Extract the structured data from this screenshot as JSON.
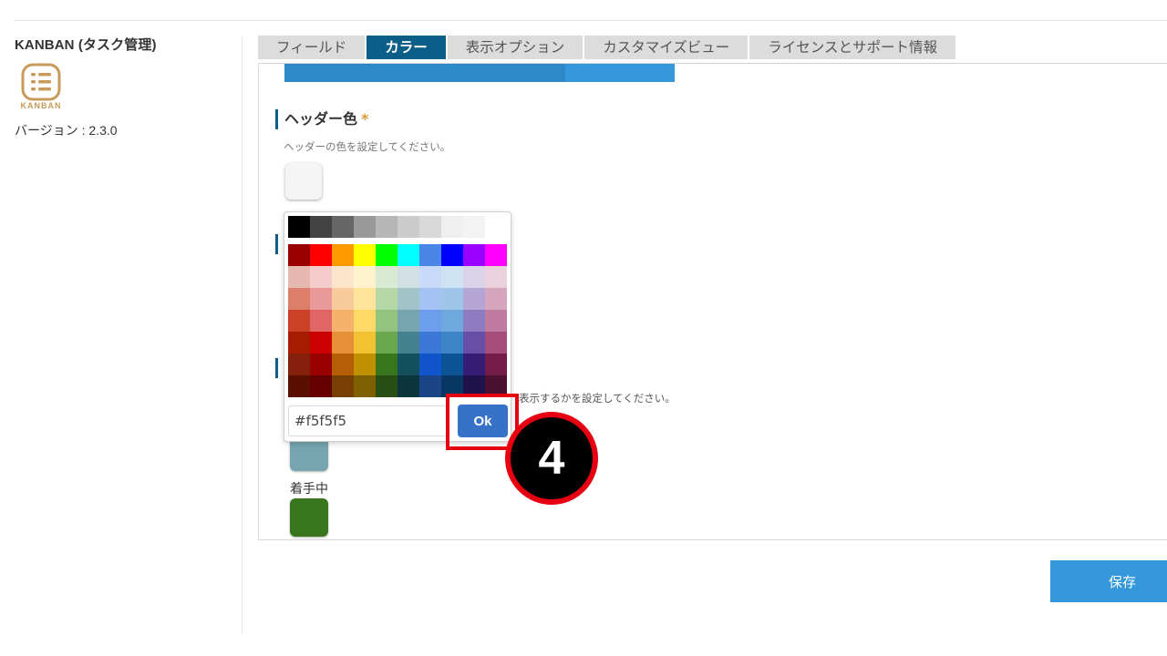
{
  "sidebar": {
    "app_name": "KANBAN (タスク管理)",
    "logo_caption": "KANBAN",
    "version": "バージョン : 2.3.0"
  },
  "tabs": [
    {
      "label": "フィールド",
      "active": false
    },
    {
      "label": "カラー",
      "active": true
    },
    {
      "label": "表示オプション",
      "active": false
    },
    {
      "label": "カスタマイズビュー",
      "active": false
    },
    {
      "label": "ライセンスとサポート情報",
      "active": false
    }
  ],
  "header_color": {
    "title": "ヘッダー色",
    "required_mark": "*",
    "description": "ヘッダーの色を設定してください。",
    "value": "#f5f5f5"
  },
  "background_color": {
    "description_tail": "表示するかを設定してください。"
  },
  "statuses": [
    {
      "label": "",
      "color": "#76a5af"
    },
    {
      "label": "着手中",
      "color": "#38761d"
    }
  ],
  "color_picker": {
    "grays": [
      "#000000",
      "#434343",
      "#666666",
      "#999999",
      "#b7b7b7",
      "#cccccc",
      "#d9d9d9",
      "#efefef",
      "#f3f3f3",
      "#ffffff"
    ],
    "palette": [
      [
        "#980000",
        "#ff0000",
        "#ff9900",
        "#ffff00",
        "#00ff00",
        "#00ffff",
        "#4a86e8",
        "#0000ff",
        "#9900ff",
        "#ff00ff"
      ],
      [
        "#e6b8af",
        "#f4cccc",
        "#fce5cd",
        "#fff2cc",
        "#d9ead3",
        "#d0e0e3",
        "#c9daf8",
        "#cfe2f3",
        "#d9d2e9",
        "#ead1dc"
      ],
      [
        "#dd7e6b",
        "#ea9999",
        "#f9cb9c",
        "#ffe599",
        "#b6d7a8",
        "#a2c4c9",
        "#a4c2f4",
        "#9fc5e8",
        "#b4a7d6",
        "#d5a6bd"
      ],
      [
        "#cc4125",
        "#e06666",
        "#f6b26b",
        "#ffd966",
        "#93c47d",
        "#76a5af",
        "#6d9eeb",
        "#6fa8dc",
        "#8e7cc3",
        "#c27ba0"
      ],
      [
        "#a61c00",
        "#cc0000",
        "#e69138",
        "#f1c232",
        "#6aa84f",
        "#45818e",
        "#3c78d8",
        "#3d85c6",
        "#674ea7",
        "#a64d79"
      ],
      [
        "#85200c",
        "#990000",
        "#b45f06",
        "#bf9000",
        "#38761d",
        "#134f5c",
        "#1155cc",
        "#0b5394",
        "#351c75",
        "#741b47"
      ],
      [
        "#5b0f00",
        "#660000",
        "#783f04",
        "#7f6000",
        "#274e13",
        "#0c343d",
        "#1c4587",
        "#073763",
        "#20124d",
        "#4c1130"
      ]
    ],
    "hex_value": "#f5f5f5",
    "ok_label": "Ok"
  },
  "annotation": {
    "step_number": "4"
  },
  "save_label": "保存",
  "progress_fraction": 0.72
}
